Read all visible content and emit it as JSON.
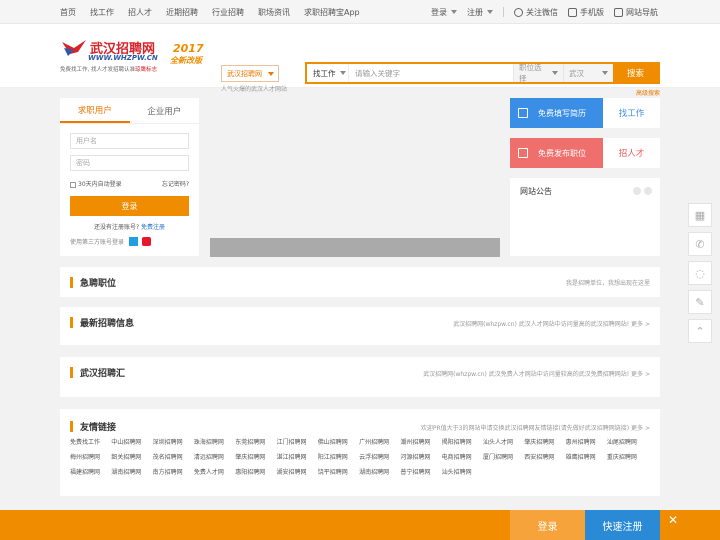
{
  "topnav": [
    "首页",
    "找工作",
    "招人才",
    "近期招聘",
    "行业招聘",
    "职场资讯",
    "求职招聘宝App"
  ],
  "topright": {
    "login": "登录",
    "register": "注册",
    "wechat": "关注微信",
    "mobile": "手机版",
    "sitenav": "网站导航"
  },
  "logo": {
    "title": "武汉招聘网",
    "url": "WWW.WHZPW.CN",
    "slogan_a": "免费找工作, 找人才发招聘认准",
    "slogan_b": "琼鹰标志",
    "year": "2017",
    "edition": "全新改版"
  },
  "site_select": {
    "label": "武汉招聘网",
    "tip": "人气火爆的武汉人才网站"
  },
  "search": {
    "type": "找工作",
    "placeholder": "请输入关键字",
    "position": "职位选择",
    "city": "武汉",
    "button": "搜索",
    "advanced": "高级搜索"
  },
  "login": {
    "tab_seeker": "求职用户",
    "tab_company": "企业用户",
    "username": "用户名",
    "password": "密码",
    "remember": "30天内自动登录",
    "forgot": "忘记密码?",
    "button": "登录",
    "no_account": "还没有注册账号?",
    "register": "免费注册",
    "third": "使用第三方账号登录"
  },
  "right_boxes": [
    {
      "left": "免费填写简历",
      "right": "找工作",
      "color": "#3a8ee6",
      "text_color": "#3a8ee6"
    },
    {
      "left": "免费发布职位",
      "right": "招人才",
      "color": "#ef6f6c",
      "text_color": "#e85a55"
    }
  ],
  "notice_title": "网站公告",
  "sections": {
    "urgent": {
      "title": "急聘职位",
      "right": "我是招聘单位，我想出现在这里"
    },
    "latest": {
      "title": "最新招聘信息",
      "right": "武汉招聘网(whzpw.cn) 武汉人才网站中访问量高的武汉招聘网站!  更多 >"
    },
    "hub": {
      "title": "武汉招聘汇",
      "right": "武汉招聘网(whzpw.cn) 武汉免费人才网站中访问量较高的武汉免费招聘网站!  更多 >"
    },
    "friends": {
      "title": "友情链接",
      "right": "欢迎PR值大于3的网站申请交换武汉招聘网友情链接(请先做好武汉招聘网链接)  更多 >"
    }
  },
  "friend_links": [
    "免费找工作",
    "中山招聘网",
    "深圳招聘网",
    "珠海招聘网",
    "东莞招聘网",
    "江门招聘网",
    "佛山招聘网",
    "广州招聘网",
    "潮州招聘网",
    "揭阳招聘网",
    "汕头人才网",
    "肇庆招聘网",
    "惠州招聘网",
    "汕尾招聘网",
    "梅州招聘网",
    "韶关招聘网",
    "茂名招聘网",
    "清远招聘网",
    "肇庆招聘网",
    "湛江招聘网",
    "阳江招聘网",
    "云浮招聘网",
    "河源招聘网",
    "电商招聘网",
    "厦门招聘网",
    "西安招聘网",
    "雄鹰招聘网",
    "重庆招聘网",
    "福建招聘网",
    "湖南招聘网",
    "南方招聘网",
    "免费人才网",
    "惠阳招聘网",
    "湖安招聘网",
    "饶平招聘网",
    "湖南招聘网",
    "普宁招聘网",
    "汕头招聘网"
  ],
  "sidebar_icons": [
    "resume-icon",
    "phone-icon",
    "qq-icon",
    "feedback-icon",
    "top-icon"
  ],
  "bottom": {
    "login": "登录",
    "register": "快速注册",
    "close": "✕"
  }
}
